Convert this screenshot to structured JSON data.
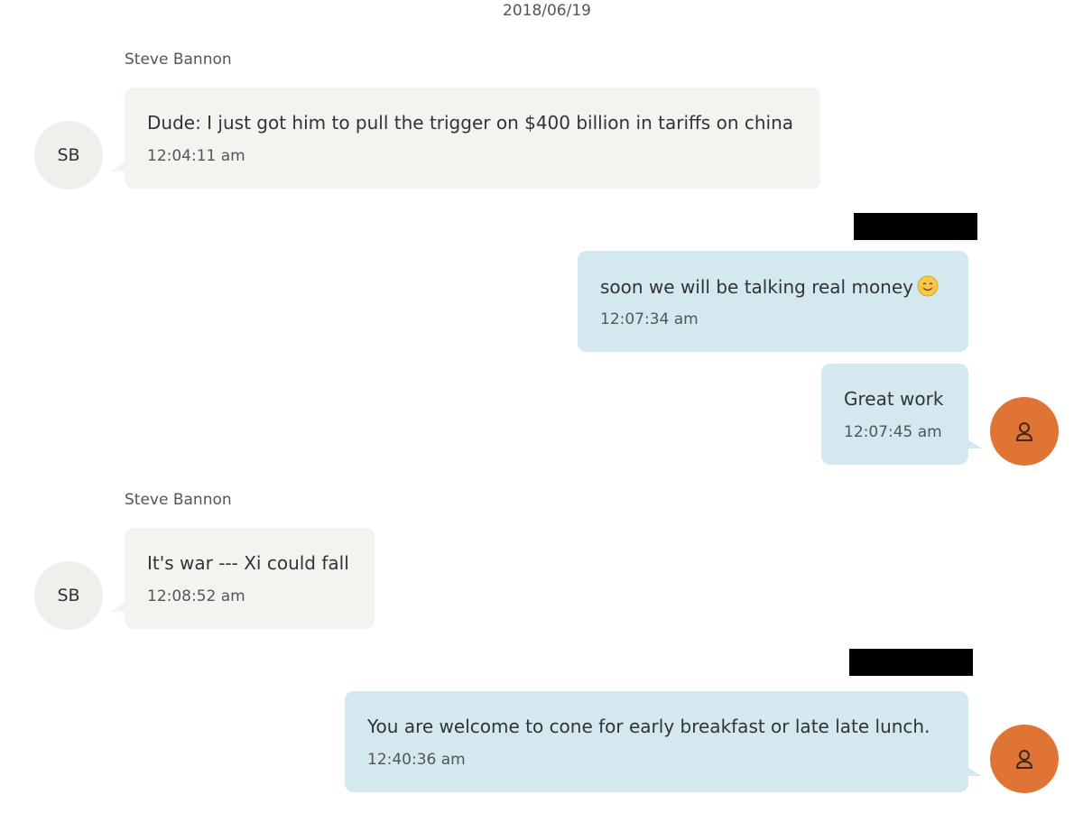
{
  "conversation": {
    "date": "2018/06/19"
  },
  "messages": [
    {
      "direction": "incoming",
      "sender_name": "Steve Bannon",
      "avatar_initials": "SB",
      "text": "Dude: I just got him to pull the trigger on $400 billion in tariffs on china",
      "time": "12:04:11 am"
    },
    {
      "direction": "outgoing",
      "sender_name_redacted": true,
      "text": "soon we will be talking real money",
      "emoji": "smiling-face-emoji",
      "time": "12:07:34 am"
    },
    {
      "direction": "outgoing",
      "text": "Great work",
      "time": "12:07:45 am",
      "avatar_icon": "user-icon"
    },
    {
      "direction": "incoming",
      "sender_name": "Steve Bannon",
      "avatar_initials": "SB",
      "text": "It's war --- Xi could fall",
      "time": "12:08:52 am"
    },
    {
      "direction": "outgoing",
      "sender_name_redacted": true,
      "text": "You are welcome to cone for early breakfast or late late lunch.",
      "time": "12:40:36 am",
      "avatar_icon": "user-icon"
    }
  ],
  "colors": {
    "incoming_bubble": "#f4f3f0",
    "outgoing_bubble": "#d4e8f0",
    "incoming_avatar": "#efefeb",
    "outgoing_avatar": "#e07434",
    "redaction": "#000000"
  }
}
